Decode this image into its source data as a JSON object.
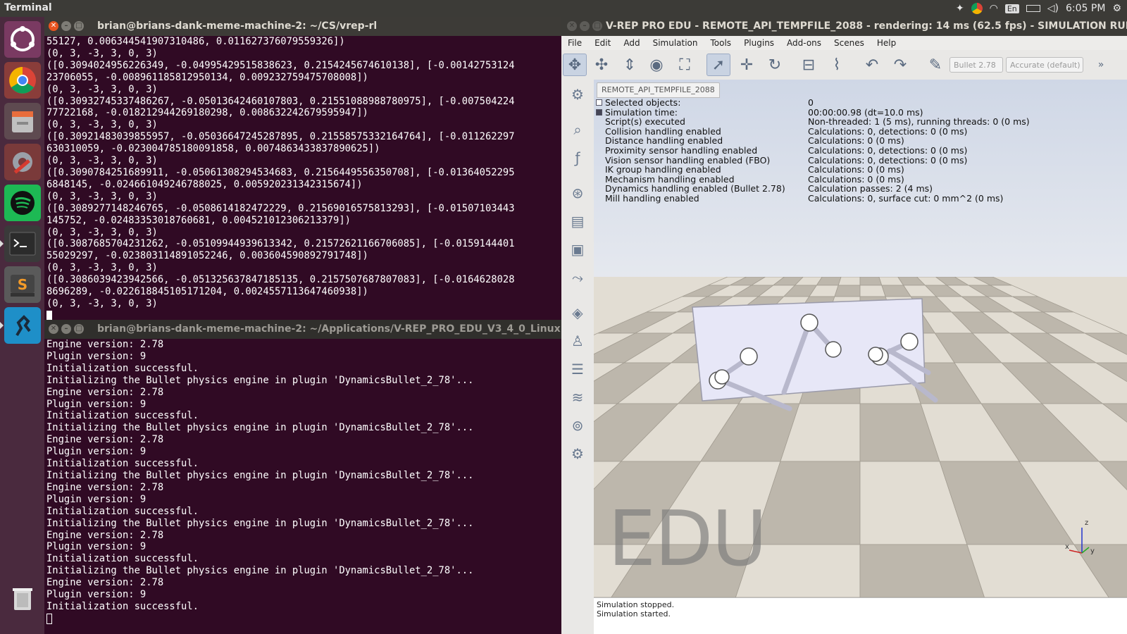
{
  "topbar": {
    "app_name": "Terminal",
    "language": "En",
    "clock": "6:05 PM"
  },
  "launcher": {
    "items": [
      "ubuntu-logo-icon",
      "chrome-icon",
      "files-icon",
      "system-settings-icon",
      "spotify-icon",
      "terminal-icon",
      "sublime-text-icon",
      "vrep-icon",
      "trash-icon"
    ]
  },
  "terminal1": {
    "title": "brian@brians-dank-meme-machine-2: ~/CS/vrep-rl",
    "lines": [
      "55127, 0.006344541907310486, 0.011627376079559326])",
      "(0, 3, -3, 3, 0, 3)",
      "([0.3094024956226349, -0.04995429515838623, 0.2154245674610138], [-0.00142753124",
      "23706055, -0.008961185812950134, 0.009232759475708008])",
      "(0, 3, -3, 3, 0, 3)",
      "([0.30932745337486267, -0.05013642460107803, 0.21551088988780975], [-0.007504224",
      "77722168, -0.018212944269180298, 0.008632242679595947])",
      "(0, 3, -3, 3, 0, 3)",
      "([0.30921483039855957, -0.05036647245287895, 0.21558575332164764], [-0.011262297",
      "630310059, -0.023004785180091858, 0.0074863433837890625])",
      "(0, 3, -3, 3, 0, 3)",
      "([0.3090784251689911, -0.05061308294534683, 0.2156449556350708], [-0.01364052295",
      "6848145, -0.024661049246788025, 0.005920231342315674])",
      "(0, 3, -3, 3, 0, 3)",
      "([0.3089277148246765, -0.0508614182472229, 0.21569016575813293], [-0.01507103443",
      "145752, -0.02483353018760681, 0.004521012306213379])",
      "(0, 3, -3, 3, 0, 3)",
      "([0.3087685704231262, -0.05109944939613342, 0.21572621166706085], [-0.0159144401",
      "55029297, -0.023803114891052246, 0.003604590892791748])",
      "(0, 3, -3, 3, 0, 3)",
      "([0.3086039423942566, -0.051325637847185135, 0.2157507687807083], [-0.0164628028",
      "8696289, -0.022618845105171204, 0.0024557113647460938])",
      "(0, 3, -3, 3, 0, 3)"
    ]
  },
  "terminal2": {
    "title": "brian@brians-dank-meme-machine-2: ~/Applications/V-REP_PRO_EDU_V3_4_0_Linux",
    "lines": [
      "Engine version: 2.78",
      "Plugin version: 9",
      "Initialization successful.",
      "Initializing the Bullet physics engine in plugin 'DynamicsBullet_2_78'...",
      "Engine version: 2.78",
      "Plugin version: 9",
      "Initialization successful.",
      "Initializing the Bullet physics engine in plugin 'DynamicsBullet_2_78'...",
      "Engine version: 2.78",
      "Plugin version: 9",
      "Initialization successful.",
      "Initializing the Bullet physics engine in plugin 'DynamicsBullet_2_78'...",
      "Engine version: 2.78",
      "Plugin version: 9",
      "Initialization successful.",
      "Initializing the Bullet physics engine in plugin 'DynamicsBullet_2_78'...",
      "Engine version: 2.78",
      "Plugin version: 9",
      "Initialization successful.",
      "Initializing the Bullet physics engine in plugin 'DynamicsBullet_2_78'...",
      "Engine version: 2.78",
      "Plugin version: 9",
      "Initialization successful."
    ]
  },
  "vrep": {
    "title": "V-REP PRO EDU - REMOTE_API_TEMPFILE_2088 - rendering: 14 ms (62.5 fps) - SIMULATION RUNNING",
    "menu": [
      "File",
      "Edit",
      "Add",
      "Simulation",
      "Tools",
      "Plugins",
      "Add-ons",
      "Scenes",
      "Help"
    ],
    "engine_select": "Bullet 2.78",
    "accuracy_select": "Accurate (default)",
    "scene_tab": "REMOTE_API_TEMPFILE_2088",
    "info": [
      {
        "key": "Selected objects:",
        "value": "0"
      },
      {
        "key": "Simulation time:",
        "value": "00:00:00.98 (dt=10.0 ms)"
      },
      {
        "key": "Script(s) executed",
        "value": "Non-threaded: 1 (5 ms), running threads: 0 (0 ms)"
      },
      {
        "key": "Collision handling enabled",
        "value": "Calculations: 0, detections: 0 (0 ms)"
      },
      {
        "key": "Distance handling enabled",
        "value": "Calculations: 0 (0 ms)"
      },
      {
        "key": "Proximity sensor handling enabled",
        "value": "Calculations: 0, detections: 0 (0 ms)"
      },
      {
        "key": "Vision sensor handling enabled (FBO)",
        "value": "Calculations: 0, detections: 0 (0 ms)"
      },
      {
        "key": "IK group handling enabled",
        "value": "Calculations: 0 (0 ms)"
      },
      {
        "key": "Mechanism handling enabled",
        "value": "Calculations: 0 (0 ms)"
      },
      {
        "key": "Dynamics handling enabled (Bullet 2.78)",
        "value": "Calculation passes: 2 (4 ms)"
      },
      {
        "key": "Mill handling enabled",
        "value": "Calculations: 0, surface cut: 0 mm^2 (0 ms)"
      }
    ],
    "watermark": "EDU",
    "axis_labels": {
      "z": "z",
      "x": "x",
      "y": "y"
    },
    "status_lines": [
      "Simulation stopped.",
      "Simulation started."
    ],
    "colors": {
      "floor_light": "#e2ddd3",
      "floor_dark": "#bdb7ac",
      "robot_body": "#e7e7f7"
    }
  }
}
